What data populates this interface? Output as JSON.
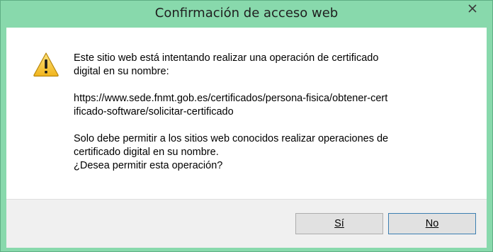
{
  "window": {
    "title": "Confirmación de acceso web"
  },
  "icons": {
    "warning": "warning-icon",
    "close": "close-icon"
  },
  "message": {
    "line1": "Este sitio web está intentando realizar una operación de certificado",
    "line2": "digital en su nombre:",
    "url_line1": "https://www.sede.fnmt.gob.es/certificados/persona-fisica/obtener-cert",
    "url_line2": "ificado-software/solicitar-certificado",
    "warning_line1": "Solo debe permitir a los sitios web conocidos realizar operaciones de",
    "warning_line2": "certificado digital en su nombre.",
    "question": "¿Desea permitir esta operación?"
  },
  "buttons": {
    "yes_label": "Sí",
    "no_label": "No"
  },
  "colors": {
    "titlebar": "#88d9ac",
    "warning_fill": "#f4c330",
    "close_glyph": "#3a3a3a"
  }
}
